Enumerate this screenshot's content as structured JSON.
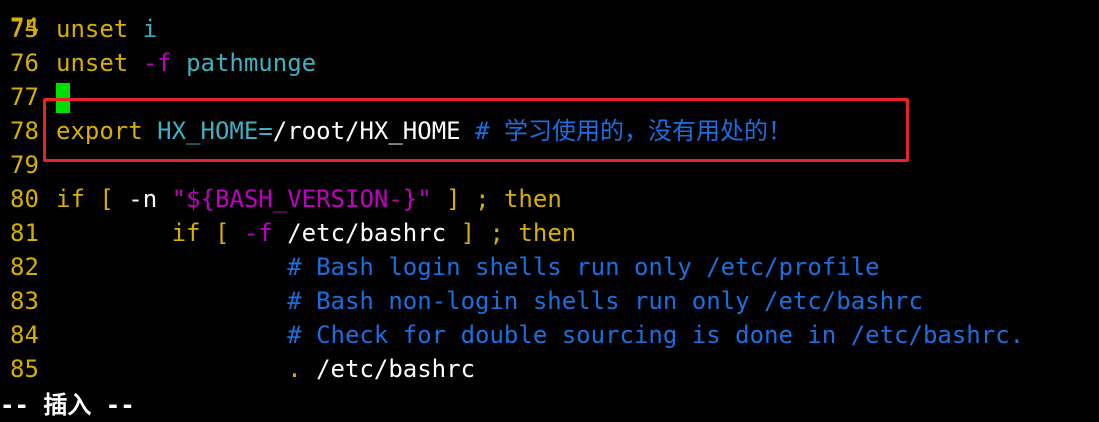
{
  "top_partial_line_number": "74",
  "lines": [
    {
      "num": "75",
      "tokens": [
        [
          "ident",
          "unset"
        ],
        [
          "text",
          " "
        ],
        [
          "var",
          "i"
        ]
      ]
    },
    {
      "num": "76",
      "tokens": [
        [
          "ident",
          "unset"
        ],
        [
          "text",
          " "
        ],
        [
          "opt",
          "-f"
        ],
        [
          "text",
          " "
        ],
        [
          "var",
          "pathmunge"
        ]
      ]
    },
    {
      "num": "77",
      "tokens": [],
      "cursor": true
    },
    {
      "num": "78",
      "tokens": [
        [
          "ident",
          "export"
        ],
        [
          "text",
          " "
        ],
        [
          "var",
          "HX_HOME"
        ],
        [
          "var",
          "="
        ],
        [
          "text",
          "/root/HX_HOME "
        ],
        [
          "comment",
          "# 学习使用的，没有用处的！"
        ]
      ]
    },
    {
      "num": "79",
      "tokens": []
    },
    {
      "num": "80",
      "tokens": [
        [
          "ident",
          "if"
        ],
        [
          "text",
          " "
        ],
        [
          "punct",
          "["
        ],
        [
          "text",
          " -n "
        ],
        [
          "str",
          "\""
        ],
        [
          "opt",
          "${BASH_VERSION-}"
        ],
        [
          "str",
          "\""
        ],
        [
          "text",
          " "
        ],
        [
          "punct",
          "]"
        ],
        [
          "text",
          " "
        ],
        [
          "punct",
          ";"
        ],
        [
          "text",
          " "
        ],
        [
          "ident",
          "then"
        ]
      ]
    },
    {
      "num": "81",
      "tokens": [
        [
          "text",
          "        "
        ],
        [
          "ident",
          "if"
        ],
        [
          "text",
          " "
        ],
        [
          "punct",
          "["
        ],
        [
          "text",
          " "
        ],
        [
          "opt",
          "-f"
        ],
        [
          "text",
          " /etc/bashrc "
        ],
        [
          "punct",
          "]"
        ],
        [
          "text",
          " "
        ],
        [
          "punct",
          ";"
        ],
        [
          "text",
          " "
        ],
        [
          "ident",
          "then"
        ]
      ]
    },
    {
      "num": "82",
      "tokens": [
        [
          "text",
          "                "
        ],
        [
          "comment",
          "# Bash login shells run only /etc/profile"
        ]
      ]
    },
    {
      "num": "83",
      "tokens": [
        [
          "text",
          "                "
        ],
        [
          "comment",
          "# Bash non-login shells run only /etc/bashrc"
        ]
      ]
    },
    {
      "num": "84",
      "tokens": [
        [
          "text",
          "                "
        ],
        [
          "comment",
          "# Check for double sourcing is done in /etc/bashrc."
        ]
      ]
    },
    {
      "num": "85",
      "tokens": [
        [
          "text",
          "                "
        ],
        [
          "punct",
          "."
        ],
        [
          "text",
          " /etc/bashrc"
        ]
      ]
    }
  ],
  "status_mode": "-- 插入 --",
  "colors": {
    "background": "#000000",
    "line_number": "#d7af00",
    "keyword": "#d7af00",
    "variable": "#3fb0c0",
    "option": "#c000c0",
    "comment": "#1a6fe0",
    "cursor": "#00e000",
    "annotation_box": "#e8232b"
  }
}
